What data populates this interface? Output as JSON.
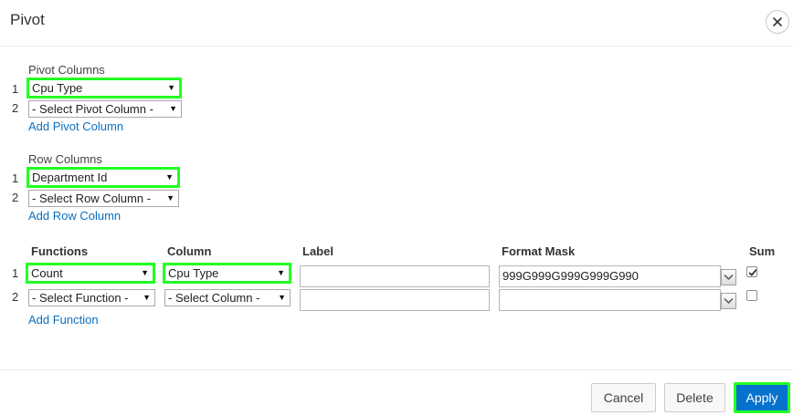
{
  "dialog": {
    "title": "Pivot"
  },
  "pivot_columns": {
    "label": "Pivot Columns",
    "rows": [
      {
        "num": "1",
        "value": "Cpu Type"
      },
      {
        "num": "2",
        "value": "- Select Pivot Column -"
      }
    ],
    "add_label": "Add Pivot Column"
  },
  "row_columns": {
    "label": "Row Columns",
    "rows": [
      {
        "num": "1",
        "value": "Department Id"
      },
      {
        "num": "2",
        "value": "- Select Row Column -"
      }
    ],
    "add_label": "Add Row Column"
  },
  "functions": {
    "headers": {
      "functions": "Functions",
      "column": "Column",
      "label": "Label",
      "format_mask": "Format Mask",
      "sum": "Sum"
    },
    "rows": [
      {
        "num": "1",
        "function": "Count",
        "column": "Cpu Type",
        "label": "",
        "format_mask": "999G999G999G999G990",
        "sum_checked": true
      },
      {
        "num": "2",
        "function": "- Select Function -",
        "column": "- Select Column -",
        "label": "",
        "format_mask": "",
        "sum_checked": false
      }
    ],
    "add_label": "Add Function"
  },
  "footer": {
    "cancel_label": "Cancel",
    "delete_label": "Delete",
    "apply_label": "Apply"
  },
  "colors": {
    "link": "#0a6fc2",
    "primary": "#0572ce",
    "highlight": "#22ff22"
  }
}
